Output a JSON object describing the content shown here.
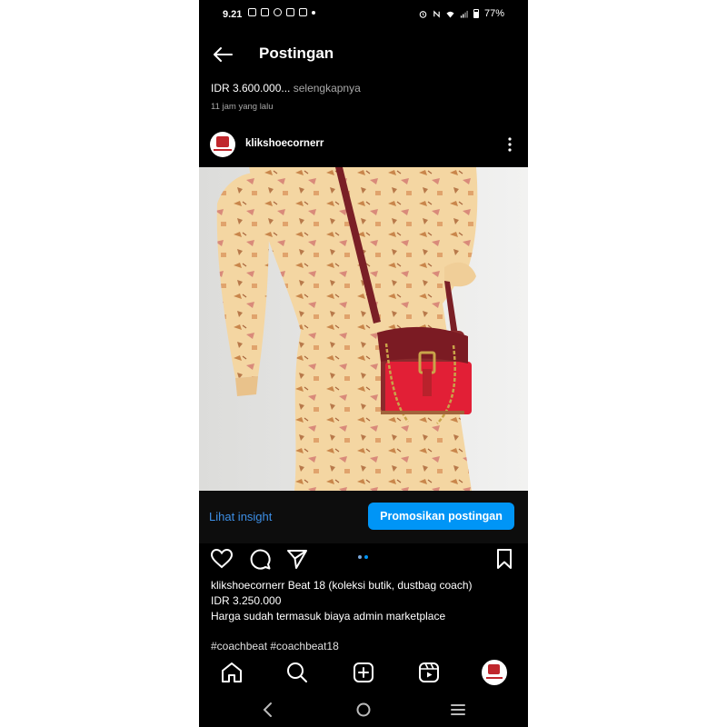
{
  "status_bar": {
    "time": "9.21",
    "battery": "77%",
    "notification_icons": [
      "calendar-icon",
      "calendar-icon",
      "whatsapp-icon",
      "calendar-icon",
      "calendar-icon",
      "dot-icon"
    ],
    "system_icons": [
      "alarm-icon",
      "nfc-icon",
      "wifi-icon",
      "signal-icon",
      "battery-icon"
    ]
  },
  "header": {
    "title": "Postingan"
  },
  "previous_post": {
    "caption": "IDR 3.600.000...",
    "more_label": " selengkapnya",
    "time": "11 jam yang lalu"
  },
  "post": {
    "username": "klikshoecornerr",
    "insight_label": "Lihat insight",
    "promote_label": "Promosikan postingan",
    "caption_user": "klikshoecornerr",
    "caption_text": " Beat 18 (koleksi butik, dustbag coach)",
    "price": "IDR 3.250.000",
    "note": "Harga sudah termasuk biaya admin marketplace",
    "hashtags": "#coachbeat #coachbeat18",
    "carousel": {
      "count": 2,
      "active": 2
    }
  },
  "bottom_nav": [
    "home-icon",
    "search-icon",
    "create-icon",
    "reels-icon",
    "profile-icon"
  ],
  "system_nav": [
    "back-icon",
    "home-icon",
    "recents-icon"
  ],
  "colors": {
    "background": "#000000",
    "accent": "#0095f6",
    "link": "#3d8fe6",
    "muted": "#a8a8a8",
    "brand_red": "#c0272d"
  }
}
